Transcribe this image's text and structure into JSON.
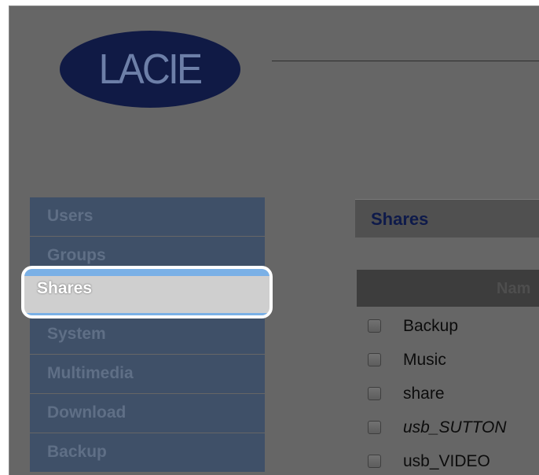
{
  "logo": {
    "text": "LACIE"
  },
  "nav": {
    "items": [
      {
        "label": "Users"
      },
      {
        "label": "Groups"
      },
      {
        "label": "Shares",
        "active": true
      },
      {
        "label": "System"
      },
      {
        "label": "Multimedia"
      },
      {
        "label": "Download"
      },
      {
        "label": "Backup"
      }
    ]
  },
  "main": {
    "title": "Shares",
    "table": {
      "column_header": "Nam",
      "rows": [
        {
          "name": "Backup",
          "italic": false
        },
        {
          "name": "Music",
          "italic": false
        },
        {
          "name": "share",
          "italic": false
        },
        {
          "name": "usb_SUTTON",
          "italic": true
        },
        {
          "name": "usb_VIDEO",
          "italic": false
        }
      ]
    }
  },
  "colors": {
    "background_overlay": "#666666",
    "logo_oval": "#101a45",
    "nav_item": "#3f5068",
    "highlight_glow": "#7ab0e6",
    "title_text": "#0e1a4a"
  }
}
